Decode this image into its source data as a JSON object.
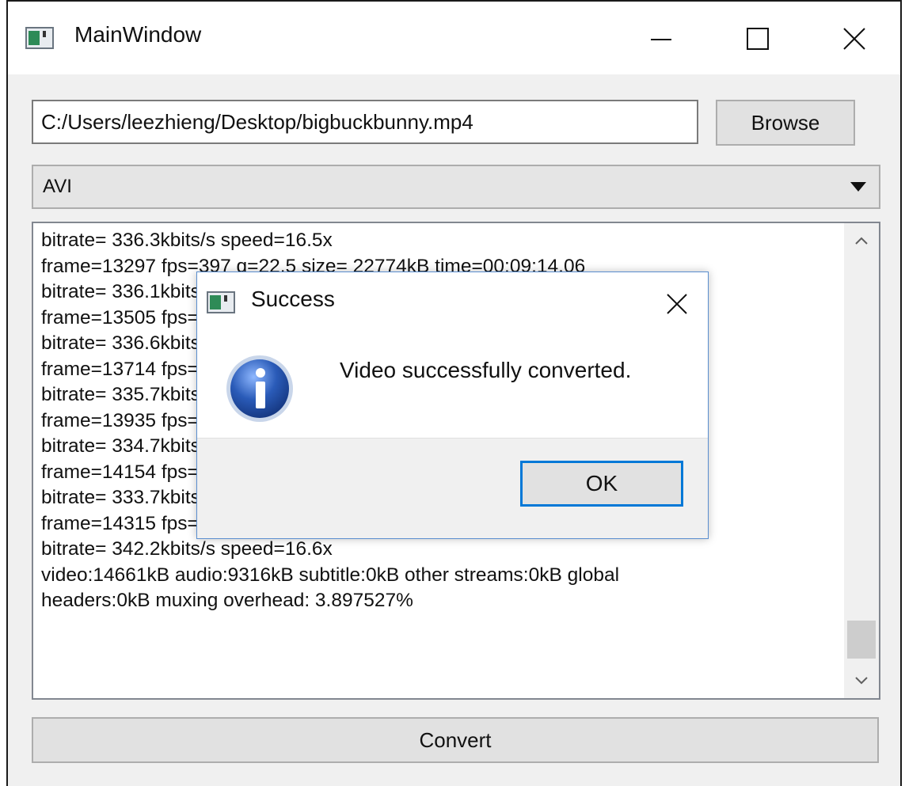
{
  "window": {
    "title": "MainWindow"
  },
  "file_path": {
    "value": "C:/Users/leezhieng/Desktop/bigbuckbunny.mp4"
  },
  "browse_button": {
    "label": "Browse"
  },
  "format_select": {
    "selected": "AVI"
  },
  "log": {
    "lines": [
      "bitrate= 336.3kbits/s speed=16.5x",
      "frame=13297 fps=397 q=22.5 size=   22774kB time=00:09:14.06",
      "bitrate= 336.1kbits/s speed=16.5x",
      "frame=13505 fps=397 q=22.5 size=   23074kB time=00:09:22.72",
      "bitrate= 336.6kbits/s speed=16.5x",
      "frame=13714 fps=398 q=22.5 size=   23354kB time=00:09:31.46",
      "bitrate= 335.7kbits/s speed=16.6x",
      "frame=13935 fps=398 q=22.5 size=   23624kB time=00:09:40.68",
      "bitrate= 334.7kbits/s speed=16.6x",
      "frame=14154 fps=399 q=22.5 size=   23894kB time=00:09:49.77",
      "bitrate= 333.7kbits/s speed=16.6x",
      "frame=14315 fps=399 q=4.9 Lsize=   24912kB time=00:09:56.45",
      "bitrate= 342.2kbits/s speed=16.6x",
      "video:14661kB audio:9316kB subtitle:0kB other streams:0kB global",
      "headers:0kB muxing overhead: 3.897527%"
    ]
  },
  "convert_button": {
    "label": "Convert"
  },
  "dialog": {
    "title": "Success",
    "message": "Video successfully converted.",
    "ok_label": "OK"
  },
  "colors": {
    "accent": "#0078d7",
    "dialog_border": "#5a8ecf",
    "info_icon": "#2a5bb8"
  },
  "icons": {
    "app": "app-window-icon",
    "info": "information-icon"
  }
}
